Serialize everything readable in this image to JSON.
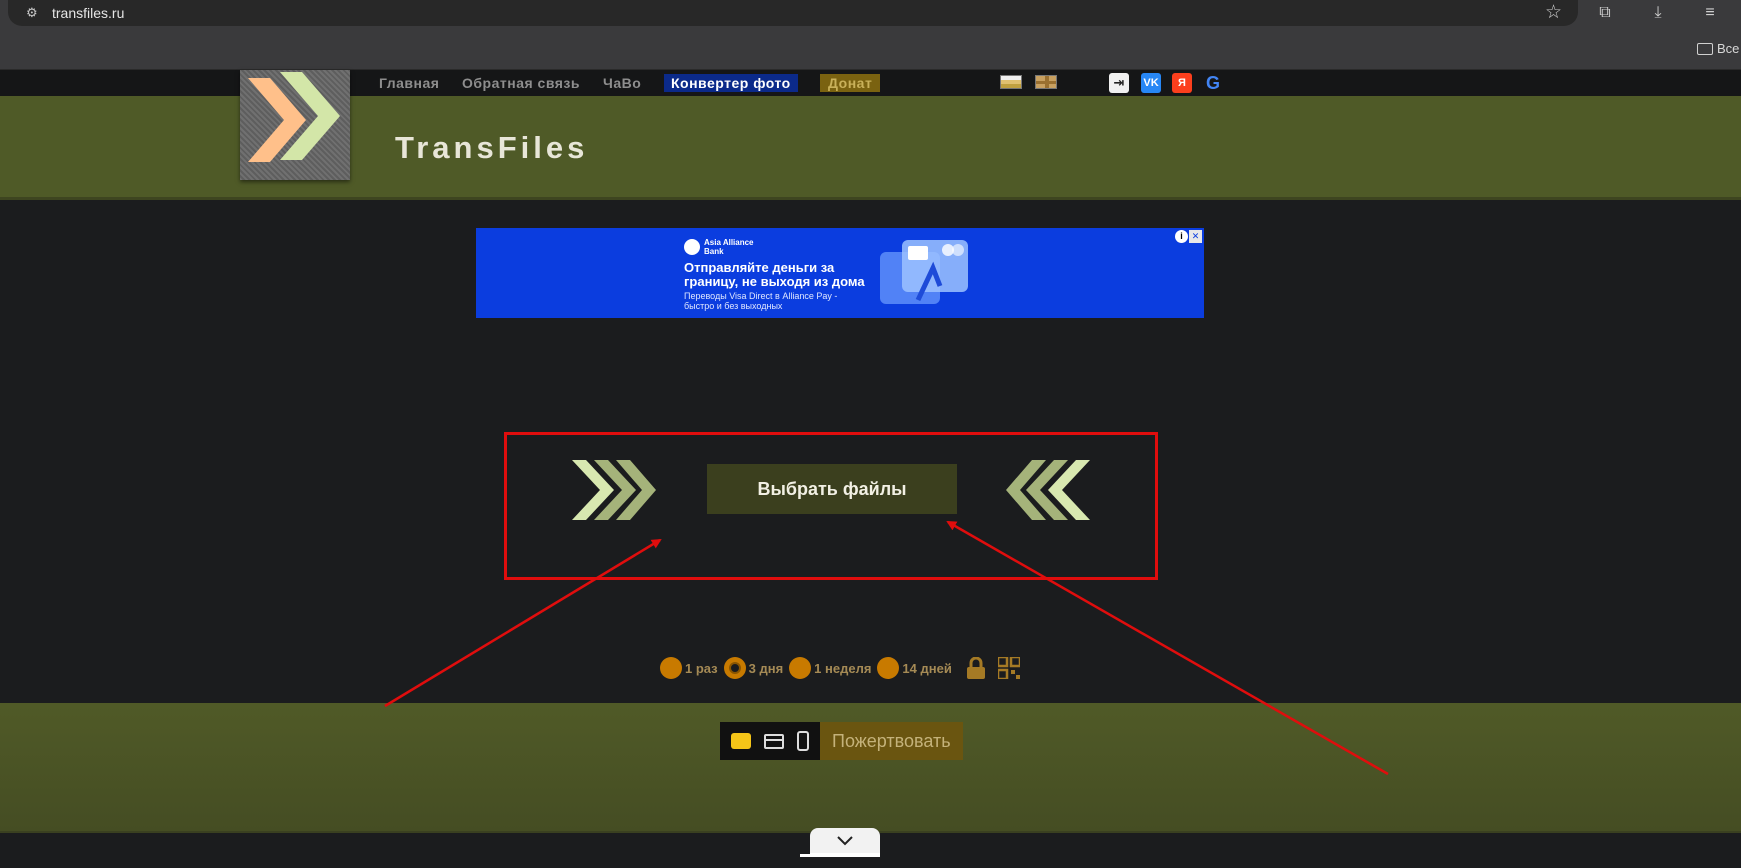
{
  "browser": {
    "url": "transfiles.ru",
    "bookmarks_folder_label": "Все",
    "icons": [
      "site-info-icon",
      "bookmark-star-icon",
      "extensions-icon",
      "download-icon",
      "reading-list-icon",
      "folder-icon"
    ]
  },
  "nav": {
    "items": [
      "Главная",
      "Обратная связь",
      "ЧаВо"
    ],
    "converter_label": "Конвертер фото",
    "donate_label": "Донат",
    "languages": [
      "ru-flag-icon",
      "uk-flag-icon"
    ],
    "social": {
      "login": "login-icon",
      "vk": "VK",
      "yandex": "Я",
      "google": "G"
    }
  },
  "header": {
    "title": "TransFiles"
  },
  "ad": {
    "brand": "Asia Alliance Bank",
    "headline": "Отправляйте деньги за границу, не выходя из дома",
    "subtext": "Переводы Visa Direct в Alliance Pay - быстро и без выходных",
    "info": "i",
    "close": "✕"
  },
  "upload": {
    "button_label": "Выбрать файлы"
  },
  "retention": {
    "options": [
      {
        "label": "1 раз",
        "checked": false
      },
      {
        "label": "3 дня",
        "checked": true
      },
      {
        "label": "1 неделя",
        "checked": false
      },
      {
        "label": "14 дней",
        "checked": false
      }
    ]
  },
  "donate": {
    "button_label": "Пожертвовать"
  },
  "colors": {
    "accent_green": "#4f5a27",
    "annotation_red": "#e00d0d",
    "radio_orange": "#c87a00"
  }
}
